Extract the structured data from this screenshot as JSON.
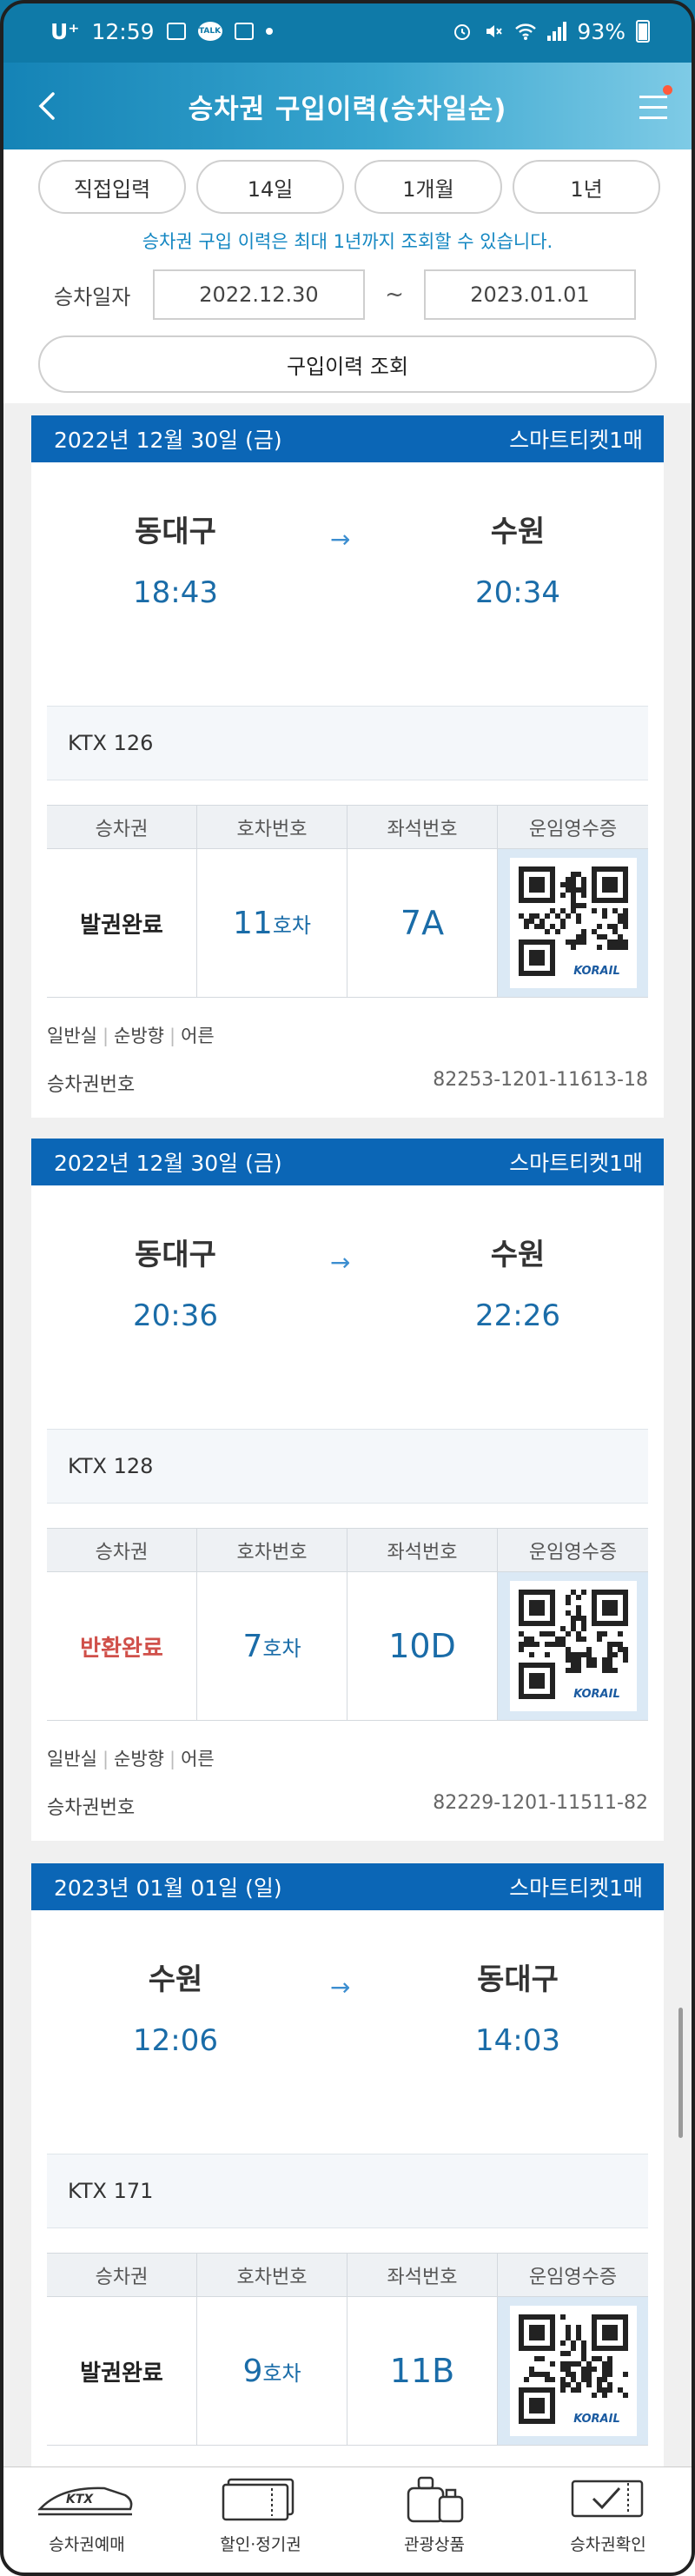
{
  "status_bar": {
    "carrier": "U⁺",
    "time": "12:59",
    "battery": "93%"
  },
  "header": {
    "title": "승차권 구입이력(승차일순)"
  },
  "filter": {
    "chips": [
      "직접입력",
      "14일",
      "1개월",
      "1년"
    ],
    "note": "승차권 구입 이력은 최대 1년까지 조회할 수 있습니다.",
    "date_label": "승차일자",
    "start_date": "2022.12.30",
    "tilde": "~",
    "end_date": "2023.01.01",
    "search_button": "구입이력 조회"
  },
  "table_headers": [
    "승차권",
    "호차번호",
    "좌석번호",
    "운임영수증"
  ],
  "tickets": [
    {
      "date": "2022년 12월 30일 (금)",
      "type": "스마트티켓1매",
      "from": "동대구",
      "to": "수원",
      "dep": "18:43",
      "arr": "20:34",
      "train": "KTX 126",
      "status": "발권완료",
      "car": "11",
      "car_unit": "호차",
      "seat": "7A",
      "class": "일반실",
      "direction": "순방향",
      "passenger": "어른",
      "ticket_label": "승차권번호",
      "ticket_no": "82253-1201-11613-18"
    },
    {
      "date": "2022년 12월 30일 (금)",
      "type": "스마트티켓1매",
      "from": "동대구",
      "to": "수원",
      "dep": "20:36",
      "arr": "22:26",
      "train": "KTX 128",
      "status": "반환완료",
      "car": "7",
      "car_unit": "호차",
      "seat": "10D",
      "class": "일반실",
      "direction": "순방향",
      "passenger": "어른",
      "ticket_label": "승차권번호",
      "ticket_no": "82229-1201-11511-82"
    },
    {
      "date": "2023년 01월 01일 (일)",
      "type": "스마트티켓1매",
      "from": "수원",
      "to": "동대구",
      "dep": "12:06",
      "arr": "14:03",
      "train": "KTX 171",
      "status": "발권완료",
      "car": "9",
      "car_unit": "호차",
      "seat": "11B"
    }
  ],
  "qr_logo": "KORAIL",
  "bottom_nav": [
    "승차권예매",
    "할인·정기권",
    "관광상품",
    "승차권확인"
  ],
  "colors": {
    "header": "#1483b6",
    "card_head": "#0b66b6",
    "accent": "#1a6ca8",
    "refund": "#d0504a"
  }
}
